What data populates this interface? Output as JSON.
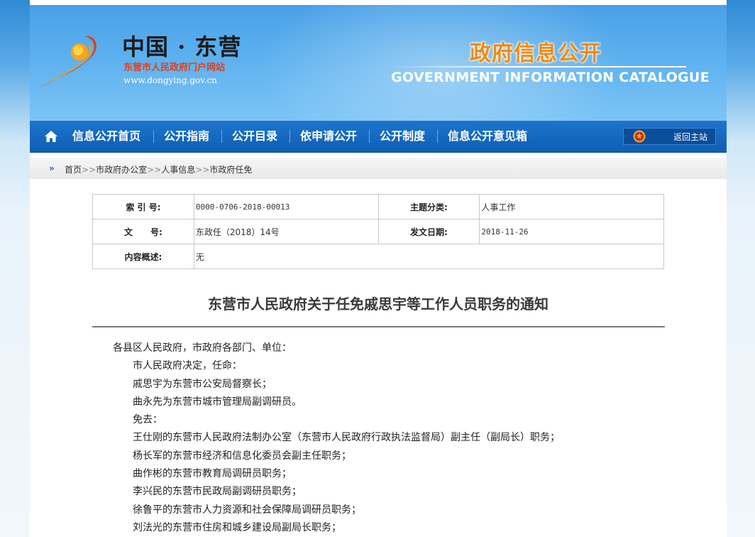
{
  "header": {
    "site_name": "中国 · 东营",
    "site_subtitle": "东营市人民政府门户网站",
    "site_url": "www.dongying.gov.cn",
    "section_title_cn": "政府信息公开",
    "section_title_en": "GOVERNMENT INFORMATION CATALOGUE"
  },
  "nav": {
    "home_icon": "home-icon",
    "items": [
      {
        "label": "信息公开首页"
      },
      {
        "label": "公开指南"
      },
      {
        "label": "公开目录"
      },
      {
        "label": "依申请公开"
      },
      {
        "label": "公开制度"
      },
      {
        "label": "信息公开意见箱"
      }
    ],
    "return_label": "返回主站",
    "return_icon": "national-emblem-icon"
  },
  "breadcrumb": {
    "icon": "double-chevron-right-icon",
    "items": [
      "首页",
      "市政府办公室",
      "人事信息",
      "市政府任免"
    ],
    "separator": ">>"
  },
  "meta": {
    "index_label": "索 引 号:",
    "index_value": "0000-0706-2018-00013",
    "category_label": "主题分类:",
    "category_value": "人事工作",
    "docno_label": "文      号:",
    "docno_value": "东政任（2018）14号",
    "date_label": "发文日期:",
    "date_value": "2018-11-26",
    "summary_label": "内容概述:",
    "summary_value": "无"
  },
  "document": {
    "title": "东营市人民政府关于任免戚思宇等工作人员职务的通知",
    "lines": [
      "各县区人民政府，市政府各部门、单位：",
      "市人民政府决定，任命：",
      "戚思宇为东营市公安局督察长；",
      "曲永先为东营市城市管理局副调研员。",
      "免去：",
      "王仕刚的东营市人民政府法制办公室（东营市人民政府行政执法监督局）副主任（副局长）职务；",
      "杨长军的东营市经济和信息化委员会副主任职务；",
      "曲作彬的东营市教育局调研员职务；",
      "李兴民的东营市民政局副调研员职务；",
      "徐鲁平的东营市人力资源和社会保障局调研员职务；",
      "刘法光的东营市住房和城乡建设局副局长职务；"
    ]
  },
  "colors": {
    "nav_bg": "#1568c0",
    "accent_orange": "#f08a10",
    "subtitle_red": "#e0401a"
  }
}
